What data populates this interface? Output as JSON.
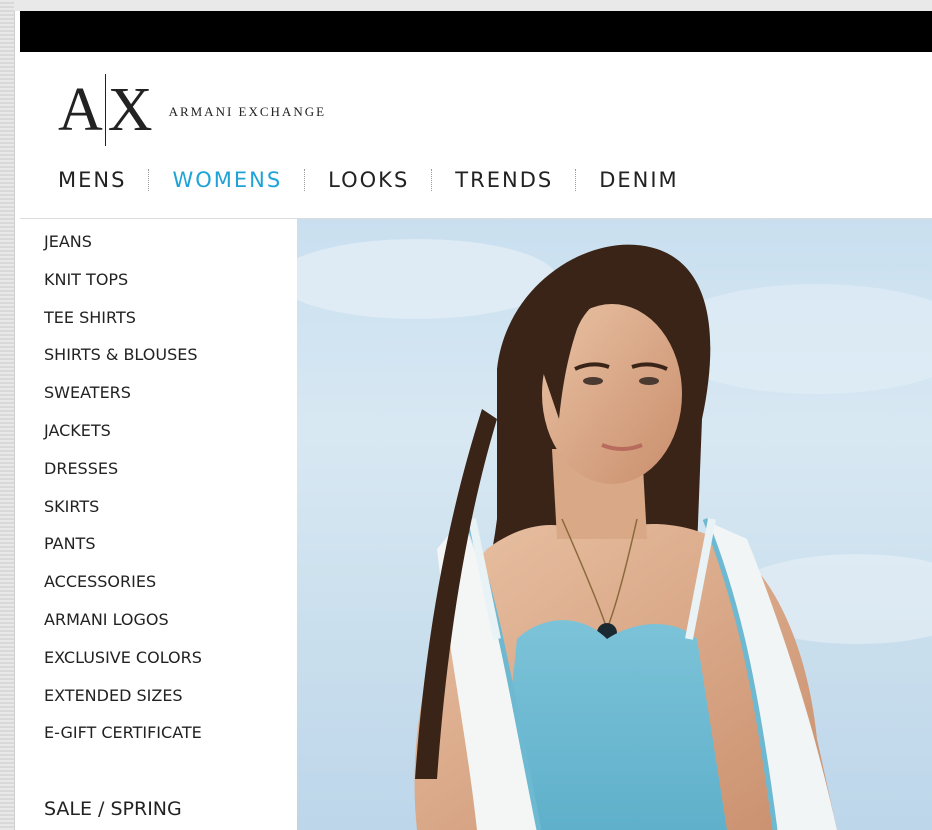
{
  "brand": {
    "mark_left": "A",
    "mark_right": "X",
    "wordmark": "ARMANI EXCHANGE"
  },
  "nav": {
    "items": [
      {
        "label": "MENS"
      },
      {
        "label": "WOMENS"
      },
      {
        "label": "LOOKS"
      },
      {
        "label": "TRENDS"
      },
      {
        "label": "DENIM"
      }
    ],
    "active": "WOMENS"
  },
  "sidebar": {
    "items": [
      {
        "label": "JEANS"
      },
      {
        "label": "KNIT TOPS"
      },
      {
        "label": "TEE SHIRTS"
      },
      {
        "label": "SHIRTS & BLOUSES"
      },
      {
        "label": "SWEATERS"
      },
      {
        "label": "JACKETS"
      },
      {
        "label": "DRESSES"
      },
      {
        "label": "SKIRTS"
      },
      {
        "label": "PANTS"
      },
      {
        "label": "ACCESSORIES"
      },
      {
        "label": "ARMANI LOGOS"
      },
      {
        "label": "EXCLUSIVE COLORS"
      },
      {
        "label": "EXTENDED SIZES"
      },
      {
        "label": "E-GIFT CERTIFICATE"
      }
    ],
    "sale_label": "SALE / SPRING"
  },
  "colors": {
    "accent": "#1fa3d6",
    "text": "#222222",
    "topbar": "#000000"
  }
}
